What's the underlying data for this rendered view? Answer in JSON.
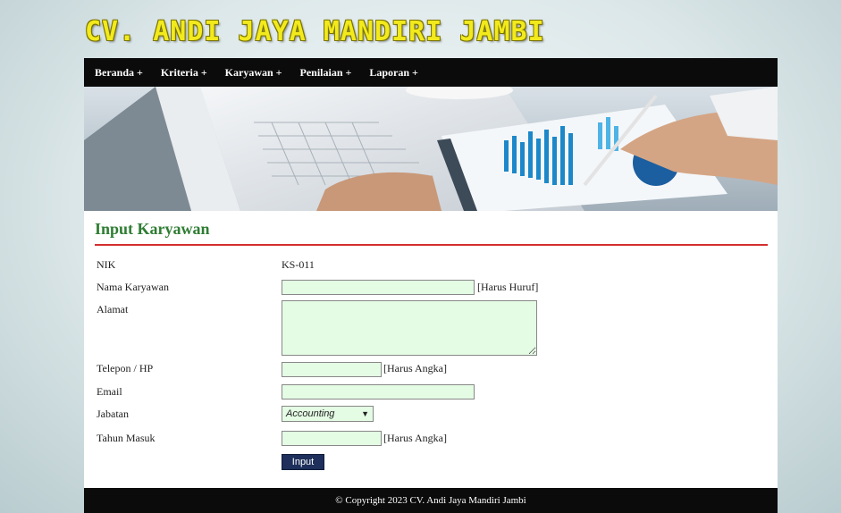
{
  "header": {
    "site_title": "CV. ANDI JAYA MANDIRI JAMBI"
  },
  "nav": {
    "items": [
      {
        "label": "Beranda +"
      },
      {
        "label": "Kriteria +"
      },
      {
        "label": "Karyawan +"
      },
      {
        "label": "Penilaian +"
      },
      {
        "label": "Laporan +"
      }
    ]
  },
  "page": {
    "title": "Input Karyawan"
  },
  "form": {
    "nik_label": "NIK",
    "nik_value": "KS-011",
    "nama_label": "Nama Karyawan",
    "nama_value": "",
    "nama_hint": "[Harus Huruf]",
    "alamat_label": "Alamat",
    "alamat_value": "",
    "telepon_label": "Telepon / HP",
    "telepon_value": "",
    "telepon_hint": "[Harus Angka]",
    "email_label": "Email",
    "email_value": "",
    "jabatan_label": "Jabatan",
    "jabatan_selected": "Accounting",
    "tahun_label": "Tahun Masuk",
    "tahun_value": "",
    "tahun_hint": "[Harus Angka]",
    "submit_label": "Input"
  },
  "footer": {
    "copyright": "© Copyright 2023 CV. Andi Jaya Mandiri Jambi"
  },
  "colors": {
    "nav_bg": "#0b0b0b",
    "title_green": "#2e7d32",
    "rule_red": "#d32f2f",
    "field_bg": "#e4fbe4",
    "button_bg": "#1d2f5a",
    "site_title_yellow": "#f2ea1c"
  }
}
